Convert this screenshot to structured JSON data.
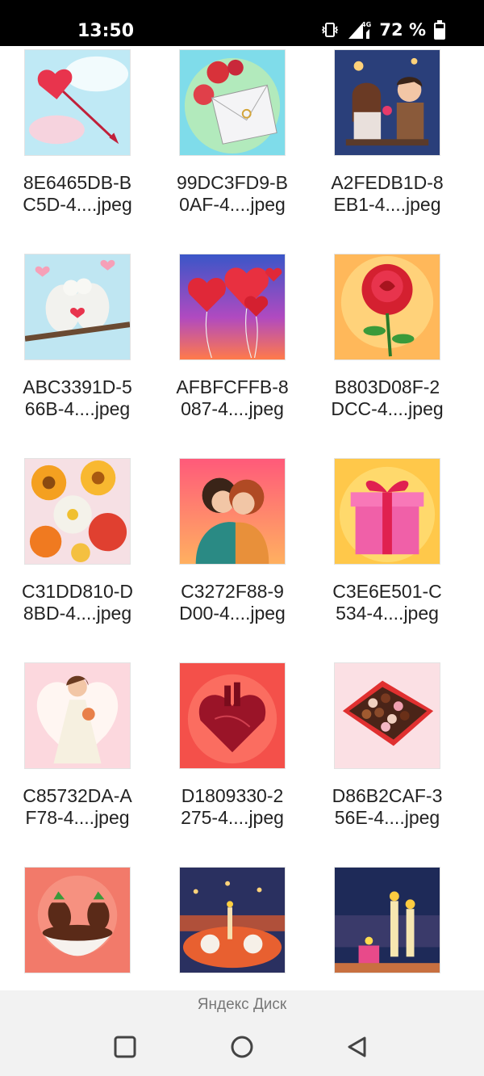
{
  "status_bar": {
    "time": "13:50",
    "network": "4G",
    "battery": "72 %"
  },
  "files": [
    {
      "name_line1": "8E6465DB-B",
      "name_line2": "C5D-4....jpeg",
      "thumb_icon": "heart-arrow-image"
    },
    {
      "name_line1": "99DC3FD9-B",
      "name_line2": "0AF-4....jpeg",
      "thumb_icon": "roses-envelope-image"
    },
    {
      "name_line1": "A2FEDB1D-8",
      "name_line2": "EB1-4....jpeg",
      "thumb_icon": "couple-date-image"
    },
    {
      "name_line1": "ABC3391D-5",
      "name_line2": "66B-4....jpeg",
      "thumb_icon": "doves-image"
    },
    {
      "name_line1": "AFBFCFFB-8",
      "name_line2": "087-4....jpeg",
      "thumb_icon": "heart-balloons-image"
    },
    {
      "name_line1": "B803D08F-2",
      "name_line2": "DCC-4....jpeg",
      "thumb_icon": "red-rose-image"
    },
    {
      "name_line1": "C31DD810-D",
      "name_line2": "8BD-4....jpeg",
      "thumb_icon": "flowers-bouquet-image"
    },
    {
      "name_line1": "C3272F88-9",
      "name_line2": "D00-4....jpeg",
      "thumb_icon": "hugging-couple-image"
    },
    {
      "name_line1": "C3E6E501-C",
      "name_line2": "534-4....jpeg",
      "thumb_icon": "gift-box-image"
    },
    {
      "name_line1": "C85732DA-A",
      "name_line2": "F78-4....jpeg",
      "thumb_icon": "bride-image"
    },
    {
      "name_line1": "D1809330-2",
      "name_line2": "275-4....jpeg",
      "thumb_icon": "anatomical-heart-image"
    },
    {
      "name_line1": "D86B2CAF-3",
      "name_line2": "56E-4....jpeg",
      "thumb_icon": "chocolate-box-image"
    },
    {
      "name_line1": "",
      "name_line2": "",
      "thumb_icon": "chocolate-strawberries-image"
    },
    {
      "name_line1": "",
      "name_line2": "",
      "thumb_icon": "candlelit-dinner-image"
    },
    {
      "name_line1": "",
      "name_line2": "",
      "thumb_icon": "candles-image"
    }
  ],
  "bottom": {
    "app_label": "Яндекс Диск"
  },
  "nav": {
    "recents_icon": "square-icon",
    "home_icon": "circle-icon",
    "back_icon": "triangle-back-icon"
  }
}
